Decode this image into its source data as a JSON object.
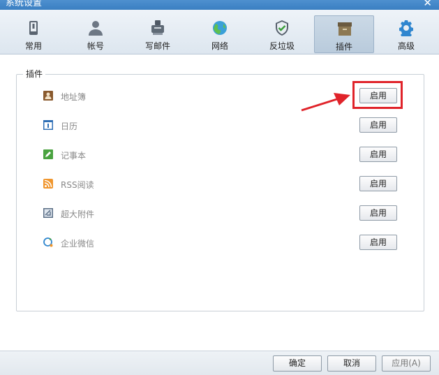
{
  "window": {
    "title": "系统设置",
    "close_glyph": "✕"
  },
  "tabs": [
    {
      "label": "常用",
      "icon": "phone-icon"
    },
    {
      "label": "帐号",
      "icon": "user-icon"
    },
    {
      "label": "写邮件",
      "icon": "compose-icon"
    },
    {
      "label": "网络",
      "icon": "globe-icon"
    },
    {
      "label": "反垃圾",
      "icon": "shield-icon"
    },
    {
      "label": "插件",
      "icon": "box-icon",
      "active": true
    },
    {
      "label": "高级",
      "icon": "gear-icon"
    }
  ],
  "plugins_group": {
    "title": "插件",
    "items": [
      {
        "name": "地址簿",
        "icon": "contacts-icon",
        "button": "启用"
      },
      {
        "name": "日历",
        "icon": "calendar-icon",
        "button": "启用"
      },
      {
        "name": "记事本",
        "icon": "notepad-icon",
        "button": "启用"
      },
      {
        "name": "RSS阅读",
        "icon": "rss-icon",
        "button": "启用"
      },
      {
        "name": "超大附件",
        "icon": "attachment-icon",
        "button": "启用"
      },
      {
        "name": "企业微信",
        "icon": "wework-icon",
        "button": "启用"
      }
    ]
  },
  "footer": {
    "ok": "确定",
    "cancel": "取消",
    "apply": "应用(A)"
  },
  "colors": {
    "highlight": "#e0232a",
    "accent": "#3a7fc2"
  }
}
